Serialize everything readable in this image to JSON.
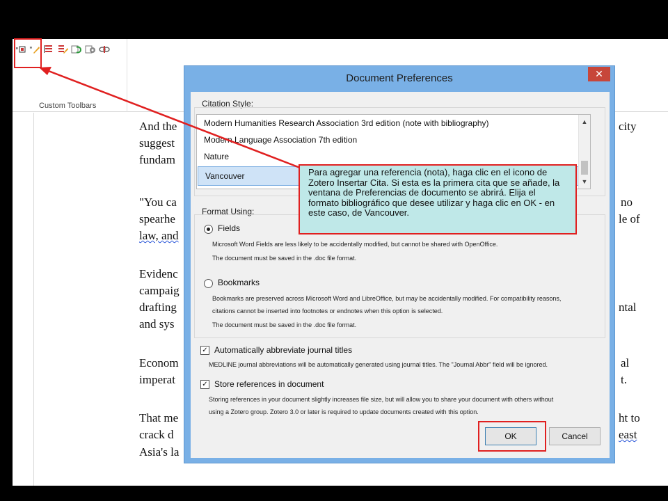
{
  "ribbon": {
    "group_label": "Custom Toolbars",
    "icons": [
      "zotero-add-citation-icon",
      "zotero-edit-citation-icon",
      "zotero-add-bibliography-icon",
      "zotero-edit-bibliography-icon",
      "zotero-refresh-icon",
      "zotero-preferences-icon",
      "zotero-unlink-icon"
    ]
  },
  "document": {
    "lines_left": [
      "And the",
      "suggest",
      "fundam",
      "\"You ca",
      "spearhe",
      "law, and",
      "Evidenc",
      "campaig",
      "drafting",
      "and sys",
      "Econom",
      "imperat",
      "That me",
      "crack d",
      "Asia's la"
    ],
    "lines_right": [
      "city",
      "no",
      "le of",
      "ntal",
      "al",
      "t.",
      "ht to",
      "east"
    ]
  },
  "dialog": {
    "title": "Document Preferences",
    "close_label": "✕",
    "citation_style_label": "Citation Style:",
    "styles": [
      "Modern Humanities Research Association 3rd edition (note with bibliography)",
      "Modern Language Association 7th edition",
      "Nature",
      "Vancouver"
    ],
    "selected_style": "Vancouver",
    "format_using_label": "Format Using:",
    "fields_label": "Fields",
    "fields_desc_1": "Microsoft Word Fields are less likely to be accidentally modified, but cannot be shared with OpenOffice.",
    "fields_desc_2": "The document must be saved in the .doc file format.",
    "bookmarks_label": "Bookmarks",
    "bookmarks_desc_1": "Bookmarks are preserved across Microsoft Word and LibreOffice, but may be accidentally modified. For compatibility reasons,",
    "bookmarks_desc_2": "citations cannot be inserted into footnotes or endnotes when this option is selected.",
    "bookmarks_desc_3": "The document must be saved in the .doc file format.",
    "abbrev_label": "Automatically abbreviate journal titles",
    "abbrev_desc": "MEDLINE journal abbreviations will be automatically generated using journal titles. The \"Journal Abbr\" field will be ignored.",
    "store_label": "Store references in document",
    "store_desc_1": "Storing references in your document slightly increases file size, but will allow you to share your document with others without",
    "store_desc_2": "using a Zotero group. Zotero 3.0 or later is required to update documents created with this option.",
    "ok_label": "OK",
    "cancel_label": "Cancel"
  },
  "annotation": {
    "callout_text": "Para agregar una referencia (nota), haga clic en el icono de Zotero Insertar Cita. Si esta es la primera cita que se añade, la ventana de Preferencias de documento se abrirá. Elija el formato bibliográfico que desee utilizar y haga clic en OK - en este caso, de Vancouver.",
    "color": "#e02020"
  },
  "colors": {
    "dialog_frame": "#79b0e6",
    "close_button": "#c7463a",
    "selection": "#cfe3f7",
    "callout_bg": "#bfe8e8"
  }
}
